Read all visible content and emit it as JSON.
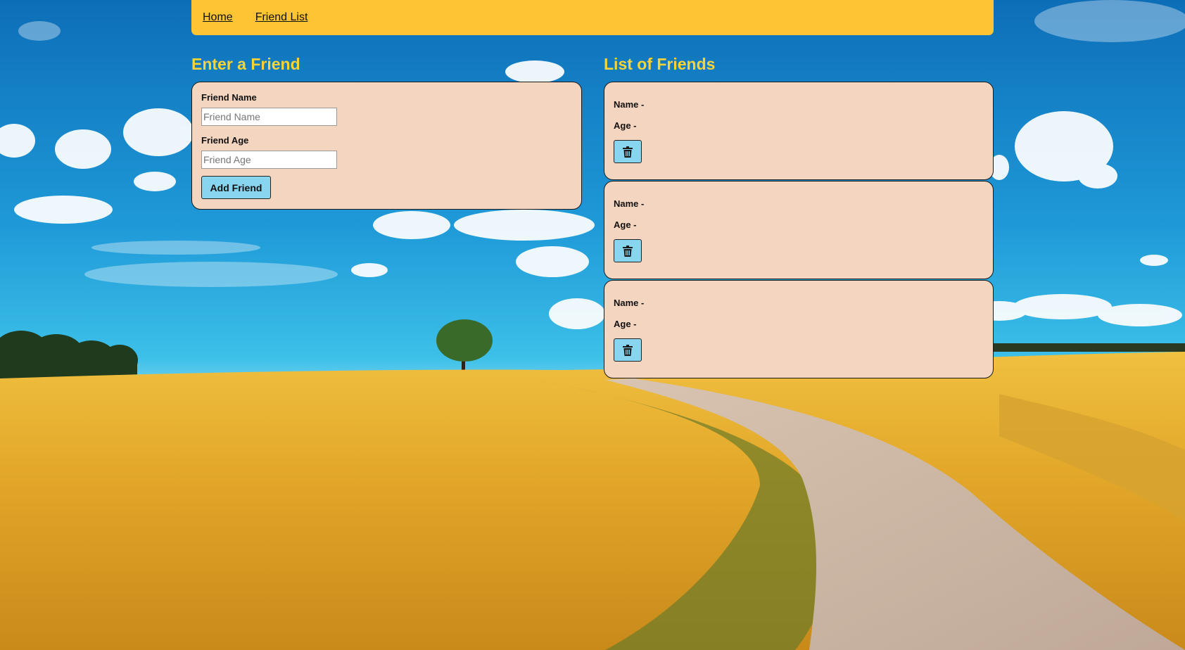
{
  "nav": {
    "items": [
      {
        "label": "Home"
      },
      {
        "label": "Friend List"
      }
    ]
  },
  "form": {
    "heading": "Enter a Friend",
    "name_label": "Friend Name",
    "name_placeholder": "Friend Name",
    "name_value": "",
    "age_label": "Friend Age",
    "age_placeholder": "Friend Age",
    "age_value": "",
    "submit_label": "Add Friend"
  },
  "list": {
    "heading": "List of Friends",
    "friends": [
      {
        "name_line": "Name -",
        "age_line": "Age -",
        "delete_icon": "trash-icon"
      },
      {
        "name_line": "Name -",
        "age_line": "Age -",
        "delete_icon": "trash-icon"
      },
      {
        "name_line": "Name -",
        "age_line": "Age -",
        "delete_icon": "trash-icon"
      }
    ]
  },
  "colors": {
    "nav_bg": "#fdc434",
    "heading": "#f7d33a",
    "card_bg": "#f4d5bf",
    "button_bg": "#87d5ee",
    "sky": "#1a8ad0",
    "wheat": "#e8b23a"
  }
}
